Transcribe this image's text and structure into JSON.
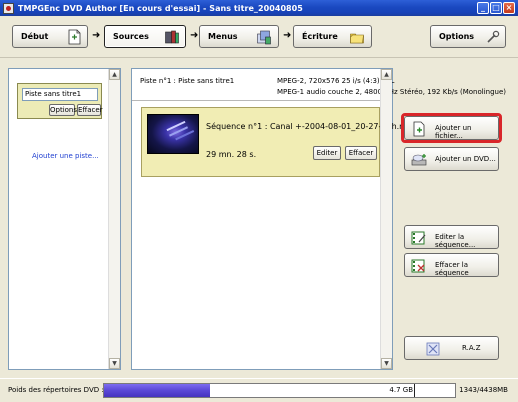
{
  "window": {
    "title": "TMPGEnc DVD Author [En cours d'essai] - Sans titre_20040805",
    "controls": [
      "_",
      "□",
      "×"
    ]
  },
  "toolbar": {
    "steps": [
      {
        "label": "Début",
        "icon": "document-icon"
      },
      {
        "label": "Sources",
        "icon": "film-books-icon",
        "active": true
      },
      {
        "label": "Menus",
        "icon": "menu-stack-icon"
      },
      {
        "label": "Écriture",
        "icon": "folder-disc-icon"
      }
    ],
    "arrow": "➜",
    "options_label": "Options"
  },
  "left_panel": {
    "track_name": "Piste sans titre1",
    "options_label": "Options",
    "delete_label": "Effacer",
    "add_track_link": "Ajouter une piste..."
  },
  "main_panel": {
    "track_label": "Piste n°1 : Piste sans titre1",
    "video_info": "MPEG-2, 720x576 25 i/s (4:3) PAL",
    "audio_info": "MPEG-1 audio couche 2, 48000 Hz Stéréo, 192 Kb/s (Monolingue)",
    "sequence": {
      "title": "Séquence n°1 : Canal +-2004-08-01_20-27-48h.mpg",
      "duration": "29 mn. 28 s.",
      "edit_label": "Editer",
      "delete_label": "Effacer"
    }
  },
  "actions": {
    "add_file": "Ajouter un fichier...",
    "add_dvd": "Ajouter un DVD...",
    "edit_sequence": "Editer la séquence...",
    "delete_sequence": "Effacer la séquence",
    "reset": "R.A.Z"
  },
  "status": {
    "label": "Poids des répertoires DVD :",
    "capacity_text": "4.7 GB",
    "usage_text": "1343/4438MB",
    "fill_fraction": 0.3026
  },
  "colors": {
    "highlight": "#d9262a",
    "progress": "#5a48d6",
    "link": "#1f3fd0",
    "track_card": "#ecebb6",
    "sequence_card": "#f1edb4"
  }
}
